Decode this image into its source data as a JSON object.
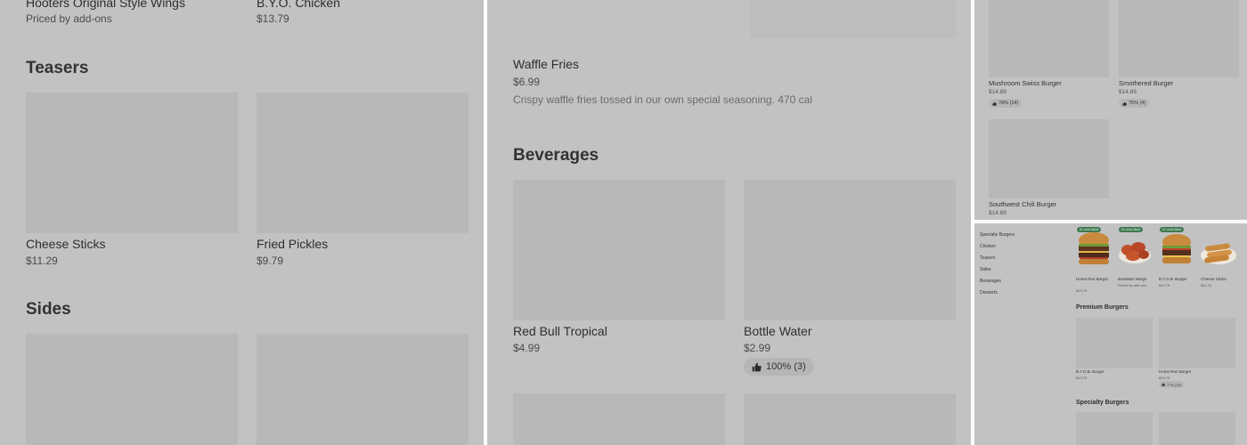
{
  "panel1": {
    "top_items": [
      {
        "name": "Hooters Original Style Wings",
        "price": "Priced by add-ons"
      },
      {
        "name": "B.Y.O. Chicken",
        "price": "$13.79"
      }
    ],
    "teasers": {
      "title": "Teasers",
      "items": [
        {
          "name": "Cheese Sticks",
          "price": "$11.29"
        },
        {
          "name": "Fried Pickles",
          "price": "$9.79"
        }
      ]
    },
    "sides": {
      "title": "Sides"
    }
  },
  "panel2": {
    "waffle": {
      "name": "Waffle Fries",
      "price": "$6.99",
      "description": "Crispy waffle fries tossed in our own special seasoning. 470 cal"
    },
    "beverages": {
      "title": "Beverages",
      "items": [
        {
          "name": "Red Bull Tropical",
          "price": "$4.99"
        },
        {
          "name": "Bottle Water",
          "price": "$2.99",
          "rating": "100% (3)"
        }
      ]
    }
  },
  "panel3": {
    "items": [
      {
        "name": "Mushroom Swiss Burger",
        "price": "$14.89",
        "rating": "78% (14)"
      },
      {
        "name": "Smothered Burger",
        "price": "$14.89",
        "rating": "75% (4)"
      },
      {
        "name": "Southwest Chili Burger",
        "price": "$14.89"
      }
    ]
  },
  "panel4": {
    "nav": [
      "Specialty Burgers",
      "Chicken",
      "Teasers",
      "Sides",
      "Beverages",
      "Desserts"
    ],
    "deal_badge": "#1 most liked",
    "featured": [
      {
        "name": "Home Run Burger",
        "price": "$19.79"
      },
      {
        "name": "Boneless Wings",
        "price": "Priced by add-ons"
      },
      {
        "name": "B.Y.O.B. Burger",
        "price": "$13.79"
      },
      {
        "name": "Cheese Sticks",
        "price": "$11.29"
      }
    ],
    "premium": {
      "title": "Premium Burgers",
      "items": [
        {
          "name": "B.Y.O.B. Burger",
          "price": "$13.79"
        },
        {
          "name": "Home Run Burger",
          "price": "$19.79",
          "rating": "77% (22)"
        }
      ]
    },
    "specialty_title": "Specialty Burgers"
  },
  "colors": {
    "overlay_gray": "#c2c2c2",
    "placeholder_gray": "#b8b8b8",
    "deal_green": "#3f7a52"
  }
}
